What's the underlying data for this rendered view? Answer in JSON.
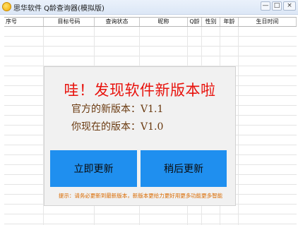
{
  "window": {
    "title": "思华软件  Q龄查询器(模拟版)",
    "buttons": {
      "minimize": "—",
      "maximize": "□",
      "close": "×"
    }
  },
  "table": {
    "columns": [
      "序号",
      "目标号码",
      "查询状态",
      "昵称",
      "Q龄",
      "性别",
      "年龄",
      "生日时间"
    ]
  },
  "dialog": {
    "headline": "哇！发现软件新版本啦",
    "official_version": "官方的新版本：V1.1",
    "current_version": "你现在的版本：V1.0",
    "update_now_label": "立即更新",
    "update_later_label": "稍后更新",
    "hint": "提示：请务必更新到最新版本，新版本更给力更好用更多功能更多智能"
  },
  "colors": {
    "headline": "#e8120c",
    "version_text": "#6a3a10",
    "button_blue": "#1f8fef",
    "hint_text": "#d96a00",
    "dialog_bg": "#f1f1f1"
  }
}
